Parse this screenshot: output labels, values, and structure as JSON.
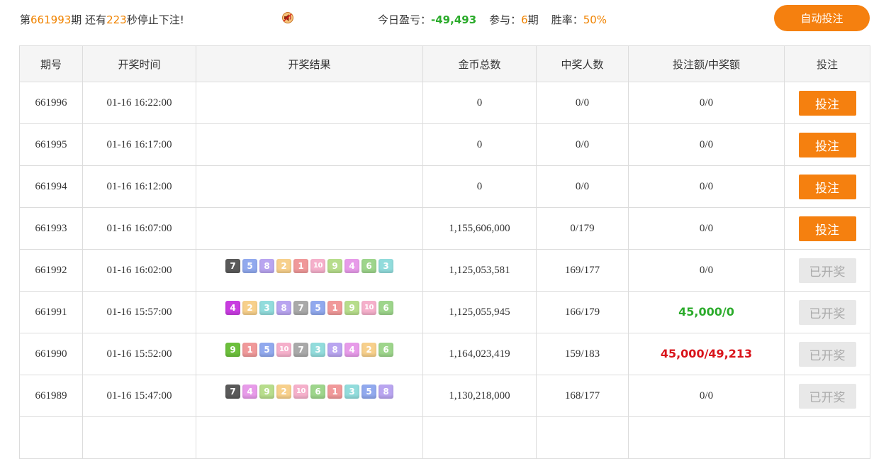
{
  "header": {
    "period_prefix": "第",
    "current_period": "661993",
    "period_suffix": "期 还有",
    "seconds_left": "223",
    "seconds_suffix": "秒停止下注!",
    "today_label": "今日盈亏：",
    "today_value": "-49,493",
    "participate_label": "参与：",
    "participate_count": "6",
    "participate_suffix": "期",
    "winrate_label": "胜率：",
    "winrate_value": "50%",
    "auto_bet_label": "自动投注",
    "speaker_icon": "speaker-icon"
  },
  "colors": {
    "accent": "#f5800f",
    "green": "#2bab2b",
    "red": "#d9141b",
    "balls": {
      "1": "#e8888a",
      "2": "#f3c77c",
      "3": "#7fd6d5",
      "4": "#c83ce0",
      "5": "#6f93e8",
      "6": "#7cc66e",
      "7": "#5a5a5a",
      "8": "#b59be8",
      "9": "#6cbf3c",
      "10": "#f2a3c6"
    },
    "balls_faded": {
      "1": "#f0999a",
      "2": "#f7d08c",
      "3": "#92dcdc",
      "4": "#e79be9",
      "5": "#91a9ee",
      "6": "#9ed58c",
      "7": "#a9a9a9",
      "8": "#b9a5f0",
      "9": "#b7dd8c",
      "10": "#f5b0cb"
    }
  },
  "table": {
    "headers": [
      "期号",
      "开奖时间",
      "开奖结果",
      "金币总数",
      "中奖人数",
      "投注额/中奖额",
      "投注"
    ],
    "rows": [
      {
        "period": "661996",
        "time": "01-16 16:22:00",
        "result": [],
        "total": "0",
        "winners": "0/0",
        "bet_win": "0/0",
        "bet_win_style": "",
        "action": "投注",
        "action_type": "bet"
      },
      {
        "period": "661995",
        "time": "01-16 16:17:00",
        "result": [],
        "total": "0",
        "winners": "0/0",
        "bet_win": "0/0",
        "bet_win_style": "",
        "action": "投注",
        "action_type": "bet"
      },
      {
        "period": "661994",
        "time": "01-16 16:12:00",
        "result": [],
        "total": "0",
        "winners": "0/0",
        "bet_win": "0/0",
        "bet_win_style": "",
        "action": "投注",
        "action_type": "bet"
      },
      {
        "period": "661993",
        "time": "01-16 16:07:00",
        "result": [],
        "total": "1,155,606,000",
        "winners": "0/179",
        "bet_win": "0/0",
        "bet_win_style": "",
        "action": "投注",
        "action_type": "bet"
      },
      {
        "period": "661992",
        "time": "01-16 16:02:00",
        "result": [
          7,
          5,
          8,
          2,
          1,
          10,
          9,
          4,
          6,
          3
        ],
        "total": "1,125,053,581",
        "winners": "169/177",
        "bet_win": "0/0",
        "bet_win_style": "",
        "action": "已开奖",
        "action_type": "done"
      },
      {
        "period": "661991",
        "time": "01-16 15:57:00",
        "result": [
          4,
          2,
          3,
          8,
          7,
          5,
          1,
          9,
          10,
          6
        ],
        "total": "1,125,055,945",
        "winners": "166/179",
        "bet_win": "45,000/0",
        "bet_win_style": "green",
        "action": "已开奖",
        "action_type": "done"
      },
      {
        "period": "661990",
        "time": "01-16 15:52:00",
        "result": [
          9,
          1,
          5,
          10,
          7,
          3,
          8,
          4,
          2,
          6
        ],
        "total": "1,164,023,419",
        "winners": "159/183",
        "bet_win": "45,000/49,213",
        "bet_win_style": "red",
        "action": "已开奖",
        "action_type": "done"
      },
      {
        "period": "661989",
        "time": "01-16 15:47:00",
        "result": [
          7,
          4,
          9,
          2,
          10,
          6,
          1,
          3,
          5,
          8
        ],
        "total": "1,130,218,000",
        "winners": "168/177",
        "bet_win": "0/0",
        "bet_win_style": "",
        "action": "已开奖",
        "action_type": "done"
      },
      {
        "period": "",
        "time": "",
        "result": [],
        "total": "",
        "winners": "",
        "bet_win": "",
        "bet_win_style": "",
        "action": "",
        "action_type": "none"
      }
    ]
  }
}
